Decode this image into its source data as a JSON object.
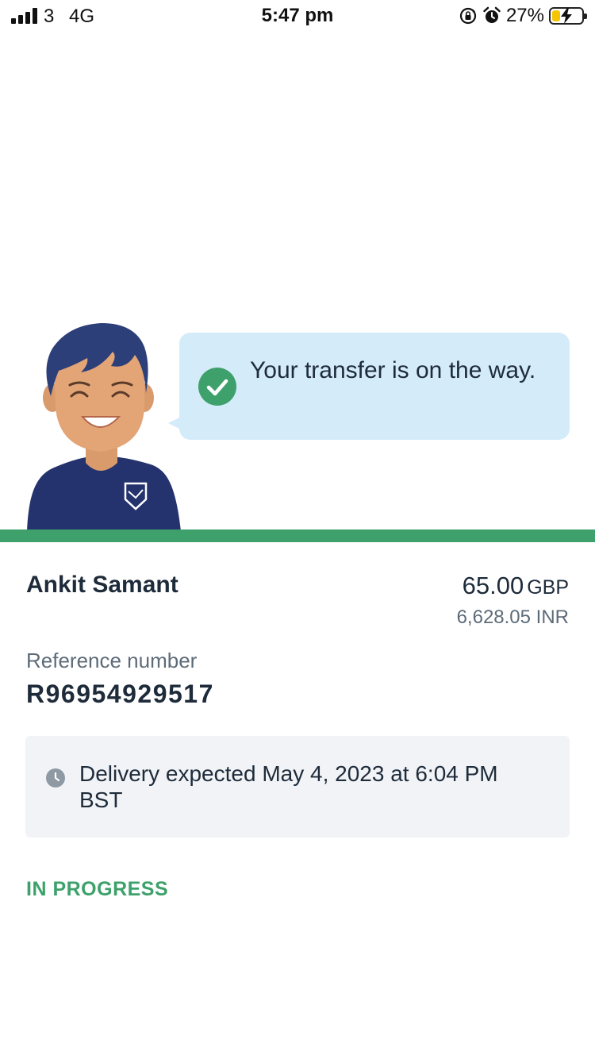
{
  "status_bar": {
    "carrier": "3",
    "network": "4G",
    "time": "5:47 pm",
    "battery_percent_label": "27%",
    "battery_level": 0.27,
    "icons": [
      "signal-icon",
      "rotation-lock-icon",
      "alarm-icon",
      "battery-charging-icon"
    ]
  },
  "hero": {
    "message": "Your transfer is on the way.",
    "check_icon": "check-circle-icon",
    "accent_color": "#3ea16b",
    "bubble_color": "#d4ebf9"
  },
  "transfer": {
    "recipient_name": "Ankit Samant",
    "source_amount": "65.00",
    "source_currency": "GBP",
    "target_amount": "6,628.05 INR",
    "reference_label": "Reference number",
    "reference_value": "R96954929517"
  },
  "delivery": {
    "icon": "clock-icon",
    "text": "Delivery expected May 4, 2023 at 6:04 PM BST"
  },
  "status": {
    "label": "IN PROGRESS",
    "color": "#3ea16b"
  }
}
